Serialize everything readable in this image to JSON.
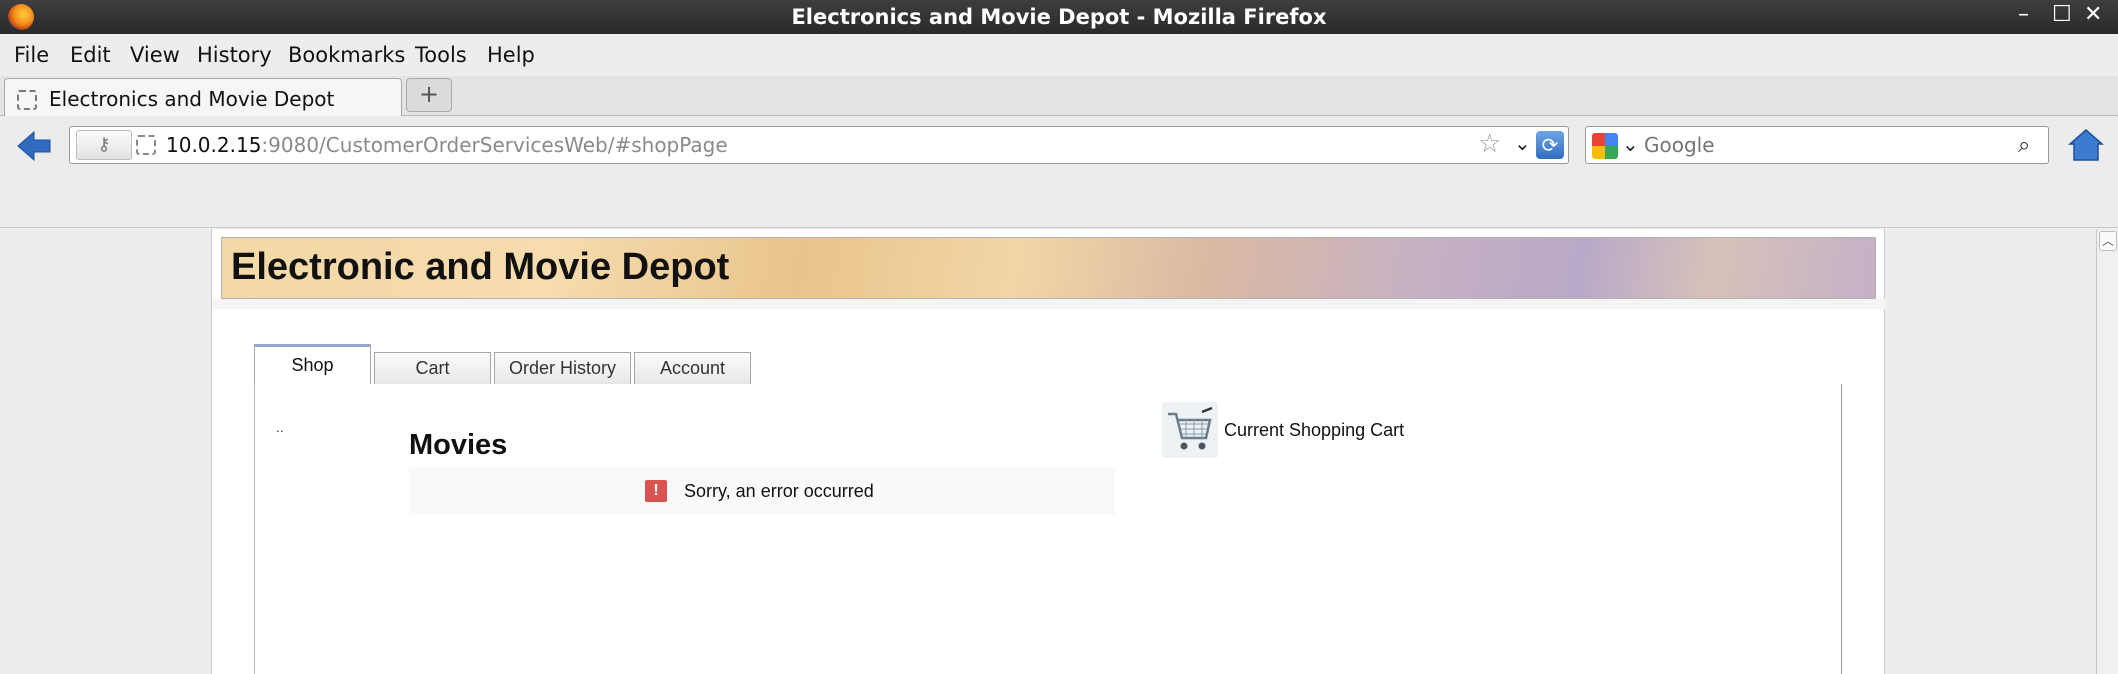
{
  "window": {
    "title": "Electronics and Movie Depot - Mozilla Firefox",
    "controls": [
      "–",
      "☐",
      "✕"
    ]
  },
  "menu": [
    "File",
    "Edit",
    "View",
    "History",
    "Bookmarks",
    "Tools",
    "Help"
  ],
  "tabs": [
    {
      "label": "Electronics and Movie Depot",
      "active": true
    }
  ],
  "newtab": {
    "label": "+"
  },
  "navbar": {
    "url_host": "10.0.2.15",
    "url_rest": ":9080/CustomerOrderServicesWeb/#shopPage",
    "search_placeholder": "Google"
  },
  "page": {
    "banner_title": "Electronic and Movie Depot",
    "tabs": [
      "Shop",
      "Cart",
      "Order History",
      "Account"
    ],
    "active_tab": "Shop",
    "dots": "..",
    "category_heading": "Movies",
    "error_message": "Sorry, an error occurred",
    "error_icon_glyph": "!",
    "cart_label": "Current Shopping Cart"
  },
  "colors": {
    "error": "#d9534f",
    "tab_active_border": "#9aa6c9"
  }
}
